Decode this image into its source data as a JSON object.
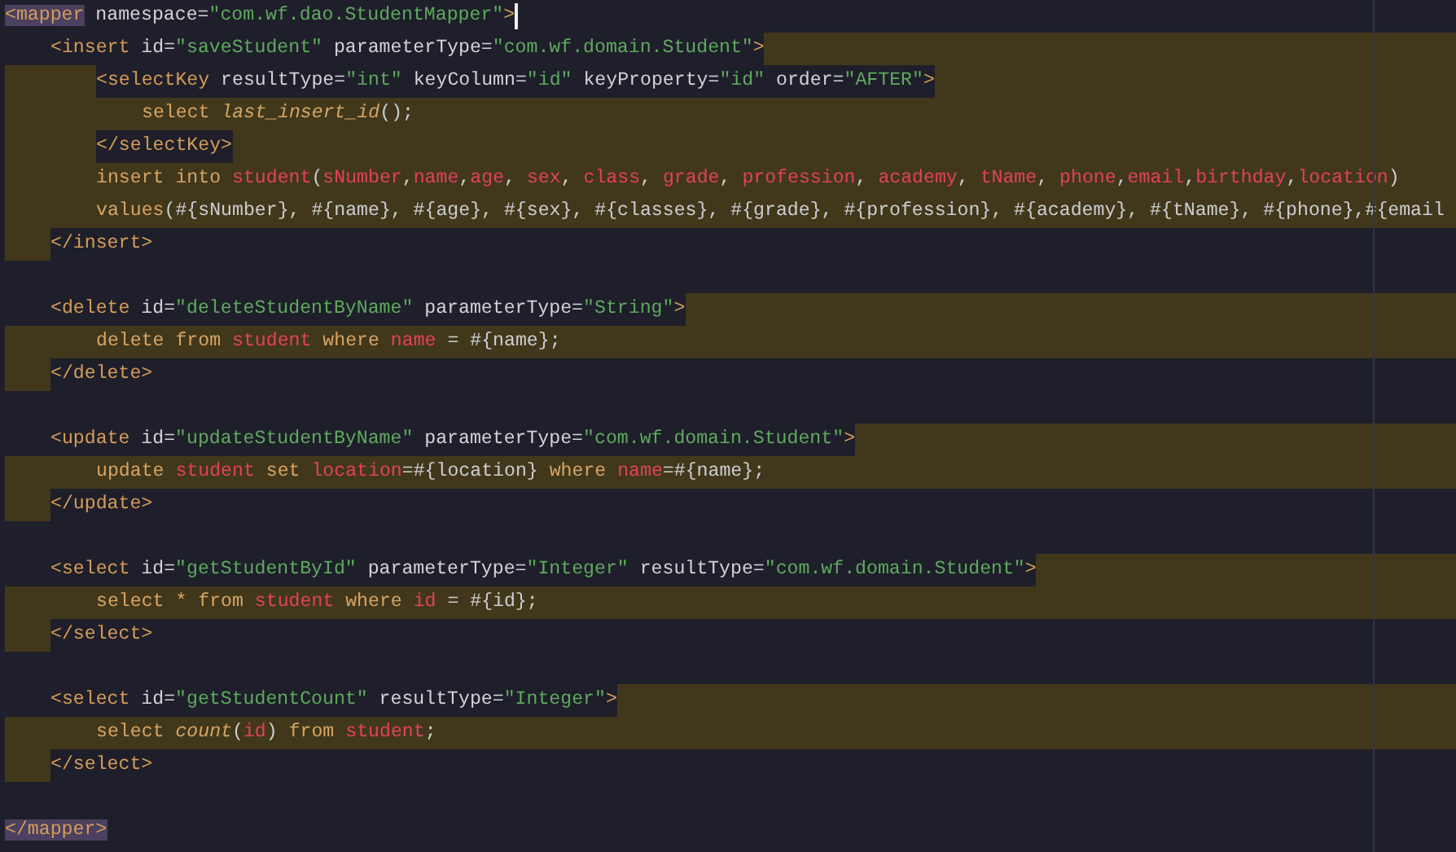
{
  "editor": {
    "lines": [
      {
        "kind": "match",
        "caret": true,
        "tokens": [
          {
            "text": "<mapper",
            "kind": "tag"
          },
          {
            "text": " namespace=",
            "kind": "attribute"
          },
          {
            "text": "\"com.wf.dao.StudentMapper\"",
            "kind": "string"
          },
          {
            "text": ">",
            "kind": "tag"
          }
        ],
        "children": [
          {
            "kind": "after",
            "tokens": [
              {
                "text": "<insert",
                "kind": "tag"
              },
              {
                "text": " id=",
                "kind": "attribute"
              },
              {
                "text": "\"saveStudent\"",
                "kind": "string"
              },
              {
                "text": " parameterType=",
                "kind": "attribute"
              },
              {
                "text": "\"com.wf.domain.Student\"",
                "kind": "string"
              },
              {
                "text": ">",
                "kind": "tag"
              }
            ],
            "children": [
              {
                "kind": "around",
                "tokens": [
                  {
                    "text": "<selectKey",
                    "kind": "tag"
                  },
                  {
                    "text": " resultType=",
                    "kind": "attribute"
                  },
                  {
                    "text": "\"int\"",
                    "kind": "string"
                  },
                  {
                    "text": " keyColumn=",
                    "kind": "attribute"
                  },
                  {
                    "text": "\"id\"",
                    "kind": "string"
                  },
                  {
                    "text": " keyProperty=",
                    "kind": "attribute"
                  },
                  {
                    "text": "\"id\"",
                    "kind": "string"
                  },
                  {
                    "text": " order=",
                    "kind": "attribute"
                  },
                  {
                    "text": "\"AFTER\"",
                    "kind": "string"
                  },
                  {
                    "text": ">",
                    "kind": "tag"
                  }
                ],
                "children": [
                  {
                    "kind": "full",
                    "tokens": [
                      {
                        "text": "select ",
                        "kind": "keyword"
                      },
                      {
                        "text": "last_insert_id",
                        "kind": "function"
                      },
                      {
                        "text": "();",
                        "kind": "plain"
                      }
                    ]
                  }
                ]
              },
              {
                "kind": "around",
                "tokens": [
                  {
                    "text": "</selectKey>",
                    "kind": "tag"
                  }
                ]
              },
              {
                "kind": "full",
                "tokens": [
                  {
                    "text": "insert into ",
                    "kind": "keyword"
                  },
                  {
                    "text": "student",
                    "kind": "identifier"
                  },
                  {
                    "text": "(",
                    "kind": "plain"
                  },
                  {
                    "text": "sNumber",
                    "kind": "identifier"
                  },
                  {
                    "text": ",",
                    "kind": "plain"
                  },
                  {
                    "text": "name",
                    "kind": "identifier"
                  },
                  {
                    "text": ",",
                    "kind": "plain"
                  },
                  {
                    "text": "age",
                    "kind": "identifier"
                  },
                  {
                    "text": ", ",
                    "kind": "plain"
                  },
                  {
                    "text": "sex",
                    "kind": "identifier"
                  },
                  {
                    "text": ", ",
                    "kind": "plain"
                  },
                  {
                    "text": "class",
                    "kind": "identifier"
                  },
                  {
                    "text": ", ",
                    "kind": "plain"
                  },
                  {
                    "text": "grade",
                    "kind": "identifier"
                  },
                  {
                    "text": ", ",
                    "kind": "plain"
                  },
                  {
                    "text": "profession",
                    "kind": "identifier"
                  },
                  {
                    "text": ", ",
                    "kind": "plain"
                  },
                  {
                    "text": "academy",
                    "kind": "identifier"
                  },
                  {
                    "text": ", ",
                    "kind": "plain"
                  },
                  {
                    "text": "tName",
                    "kind": "identifier"
                  },
                  {
                    "text": ", ",
                    "kind": "plain"
                  },
                  {
                    "text": "phone",
                    "kind": "identifier"
                  },
                  {
                    "text": ",",
                    "kind": "plain"
                  },
                  {
                    "text": "email",
                    "kind": "identifier"
                  },
                  {
                    "text": ",",
                    "kind": "plain"
                  },
                  {
                    "text": "birthday",
                    "kind": "identifier"
                  },
                  {
                    "text": ",",
                    "kind": "plain"
                  },
                  {
                    "text": "location",
                    "kind": "identifier"
                  },
                  {
                    "text": ")",
                    "kind": "plain"
                  }
                ]
              },
              {
                "kind": "full",
                "tokens": [
                  {
                    "text": "values",
                    "kind": "keyword"
                  },
                  {
                    "text": "(#{sNumber}, #{name}, #{age}, #{sex}, #{classes}, #{grade}, #{profession}, #{academy}, #{tName}, #{phone},#{email",
                    "kind": "plain"
                  }
                ]
              }
            ]
          },
          {
            "kind": "before",
            "tokens": [
              {
                "text": "</insert>",
                "kind": "tag"
              }
            ]
          },
          {
            "kind": "none"
          },
          {
            "kind": "after",
            "tokens": [
              {
                "text": "<delete",
                "kind": "tag"
              },
              {
                "text": " id=",
                "kind": "attribute"
              },
              {
                "text": "\"deleteStudentByName\"",
                "kind": "string"
              },
              {
                "text": " parameterType=",
                "kind": "attribute"
              },
              {
                "text": "\"String\"",
                "kind": "string"
              },
              {
                "text": ">",
                "kind": "tag"
              }
            ],
            "children": [
              {
                "kind": "full",
                "tokens": [
                  {
                    "text": "delete from ",
                    "kind": "keyword"
                  },
                  {
                    "text": "student",
                    "kind": "identifier"
                  },
                  {
                    "text": " where ",
                    "kind": "keyword"
                  },
                  {
                    "text": "name",
                    "kind": "identifier"
                  },
                  {
                    "text": " = #{name};",
                    "kind": "plain"
                  }
                ]
              }
            ]
          },
          {
            "kind": "before",
            "tokens": [
              {
                "text": "</delete>",
                "kind": "tag"
              }
            ]
          },
          {
            "kind": "none"
          },
          {
            "kind": "after",
            "tokens": [
              {
                "text": "<update",
                "kind": "tag"
              },
              {
                "text": " id=",
                "kind": "attribute"
              },
              {
                "text": "\"updateStudentByName\"",
                "kind": "string"
              },
              {
                "text": " parameterType=",
                "kind": "attribute"
              },
              {
                "text": "\"com.wf.domain.Student\"",
                "kind": "string"
              },
              {
                "text": ">",
                "kind": "tag"
              }
            ],
            "children": [
              {
                "kind": "full",
                "tokens": [
                  {
                    "text": "update ",
                    "kind": "keyword"
                  },
                  {
                    "text": "student",
                    "kind": "identifier"
                  },
                  {
                    "text": " set ",
                    "kind": "keyword"
                  },
                  {
                    "text": "location",
                    "kind": "identifier"
                  },
                  {
                    "text": "=#{location}",
                    "kind": "plain"
                  },
                  {
                    "text": " where ",
                    "kind": "keyword"
                  },
                  {
                    "text": "name",
                    "kind": "identifier"
                  },
                  {
                    "text": "=#{name};",
                    "kind": "plain"
                  }
                ]
              }
            ]
          },
          {
            "kind": "before",
            "tokens": [
              {
                "text": "</update>",
                "kind": "tag"
              }
            ]
          },
          {
            "kind": "none"
          },
          {
            "kind": "after",
            "tokens": [
              {
                "text": "<select",
                "kind": "tag"
              },
              {
                "text": " id=",
                "kind": "attribute"
              },
              {
                "text": "\"getStudentById\"",
                "kind": "string"
              },
              {
                "text": " parameterType=",
                "kind": "attribute"
              },
              {
                "text": "\"Integer\"",
                "kind": "string"
              },
              {
                "text": " resultType=",
                "kind": "attribute"
              },
              {
                "text": "\"com.wf.domain.Student\"",
                "kind": "string"
              },
              {
                "text": ">",
                "kind": "tag"
              }
            ],
            "children": [
              {
                "kind": "full",
                "tokens": [
                  {
                    "text": "select * from ",
                    "kind": "keyword"
                  },
                  {
                    "text": "student",
                    "kind": "identifier"
                  },
                  {
                    "text": " where ",
                    "kind": "keyword"
                  },
                  {
                    "text": "id",
                    "kind": "identifier"
                  },
                  {
                    "text": " = #{id};",
                    "kind": "plain"
                  }
                ]
              }
            ]
          },
          {
            "kind": "before",
            "tokens": [
              {
                "text": "</select>",
                "kind": "tag"
              }
            ]
          },
          {
            "kind": "none"
          },
          {
            "kind": "after",
            "tokens": [
              {
                "text": "<select",
                "kind": "tag"
              },
              {
                "text": " id=",
                "kind": "attribute"
              },
              {
                "text": "\"getStudentCount\"",
                "kind": "string"
              },
              {
                "text": " resultType=",
                "kind": "attribute"
              },
              {
                "text": "\"Integer\"",
                "kind": "string"
              },
              {
                "text": ">",
                "kind": "tag"
              }
            ],
            "children": [
              {
                "kind": "full",
                "tokens": [
                  {
                    "text": "select ",
                    "kind": "keyword"
                  },
                  {
                    "text": "count",
                    "kind": "function"
                  },
                  {
                    "text": "(",
                    "kind": "plain"
                  },
                  {
                    "text": "id",
                    "kind": "identifier"
                  },
                  {
                    "text": ") ",
                    "kind": "plain"
                  },
                  {
                    "text": "from ",
                    "kind": "keyword"
                  },
                  {
                    "text": "student",
                    "kind": "identifier"
                  },
                  {
                    "text": ";",
                    "kind": "plain"
                  }
                ]
              }
            ]
          },
          {
            "kind": "before",
            "tokens": [
              {
                "text": "</select>",
                "kind": "tag"
              }
            ]
          },
          {
            "kind": "none"
          }
        ]
      },
      {
        "kind": "match",
        "tokens": [
          {
            "text": "</mapper>",
            "kind": "tag"
          }
        ]
      }
    ]
  }
}
